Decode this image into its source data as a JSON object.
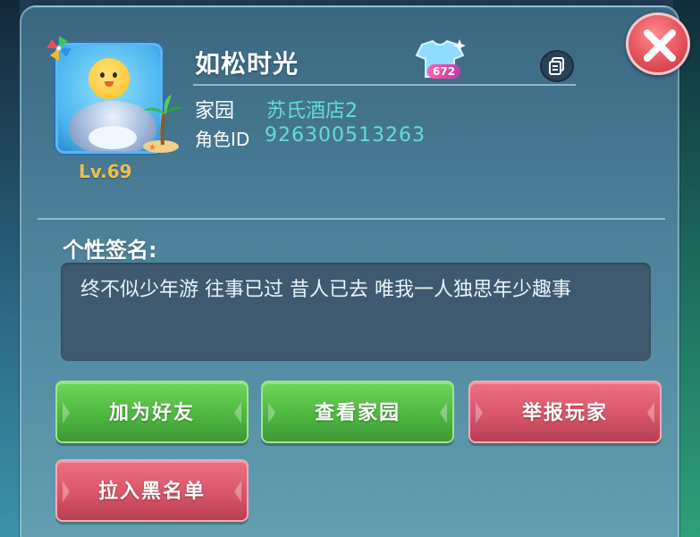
{
  "player": {
    "name": "如松时光",
    "level": "Lv.69",
    "home_label": "家园",
    "home_value": "苏氏酒店2",
    "id_label": "角色ID",
    "id_value": "926300513263",
    "outfit_count": "672"
  },
  "signature": {
    "title": "个性签名:",
    "text": "终不似少年游 往事已过 昔人已去 唯我一人独思年少趣事"
  },
  "actions": {
    "add_friend": "加为好友",
    "view_home": "查看家园",
    "report_player": "举报玩家",
    "blacklist": "拉入黑名单"
  },
  "colors": {
    "accent_teal": "#62ddd6",
    "level_gold": "#f0c04a",
    "button_green": "#4fb741",
    "button_red": "#d9556a"
  },
  "icons": {
    "close": "close-icon",
    "copy": "copy-icon",
    "outfit": "shirt-icon",
    "pinwheel": "pinwheel-icon"
  }
}
